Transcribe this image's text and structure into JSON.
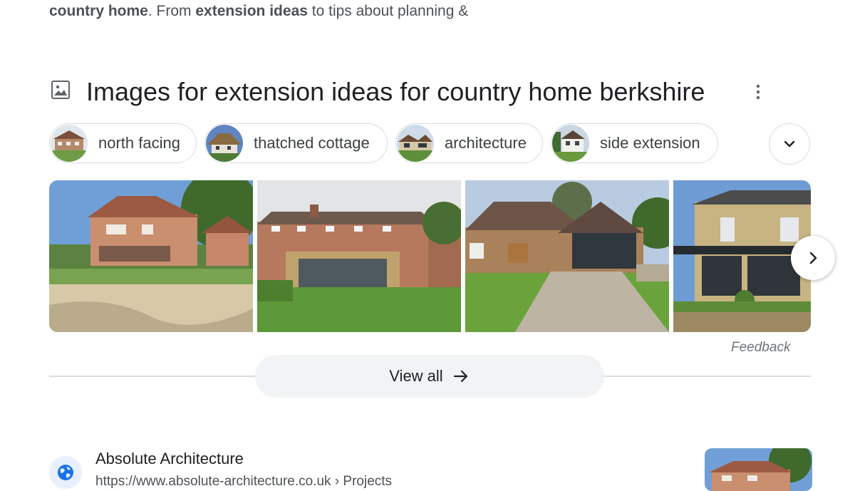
{
  "snippet": {
    "part1": "country home",
    "part2": ". From ",
    "part3": "extension ideas",
    "part4": " to tips about planning &"
  },
  "images_section": {
    "title": "Images for extension ideas for country home berkshire",
    "icon": "image-icon",
    "menu_icon": "more-vert-icon",
    "chips": [
      {
        "label": "north facing"
      },
      {
        "label": "thatched cottage"
      },
      {
        "label": "architecture"
      },
      {
        "label": "side extension"
      }
    ],
    "expand_icon": "chevron-down-icon",
    "next_icon": "chevron-right-icon",
    "feedback": "Feedback",
    "view_all": "View all"
  },
  "result": {
    "site_name": "Absolute Architecture",
    "url": "https://www.absolute-architecture.co.uk › Projects"
  }
}
